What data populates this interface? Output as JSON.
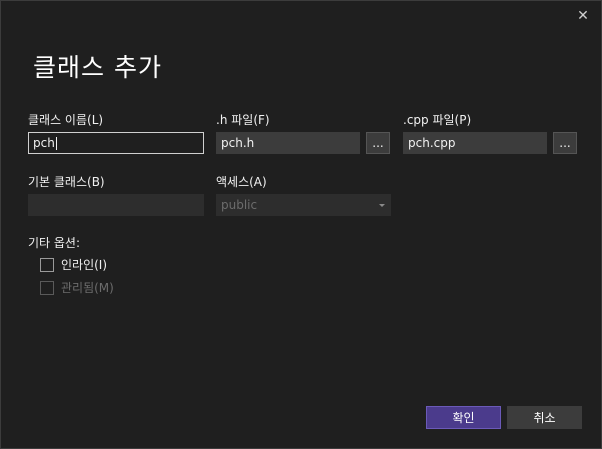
{
  "dialog": {
    "title": "클래스 추가",
    "close_icon_glyph": "✕"
  },
  "fields": {
    "class_name": {
      "label": "클래스 이름(L)",
      "value": "pch"
    },
    "h_file": {
      "label": ".h 파일(F)",
      "value": "pch.h",
      "browse_label": "..."
    },
    "cpp_file": {
      "label": ".cpp 파일(P)",
      "value": "pch.cpp",
      "browse_label": "..."
    },
    "base_class": {
      "label": "기본 클래스(B)",
      "value": ""
    },
    "access": {
      "label": "액세스(A)",
      "value": "public"
    }
  },
  "options": {
    "label": "기타 옵션:",
    "inline": {
      "label": "인라인(I)",
      "checked": false
    },
    "managed": {
      "label": "관리됨(M)",
      "checked": false,
      "disabled": true
    }
  },
  "buttons": {
    "ok": "확인",
    "cancel": "취소"
  },
  "colors": {
    "background": "#1f1f1f",
    "field": "#3c3c3c",
    "primary_button": "#4b3b8c"
  }
}
